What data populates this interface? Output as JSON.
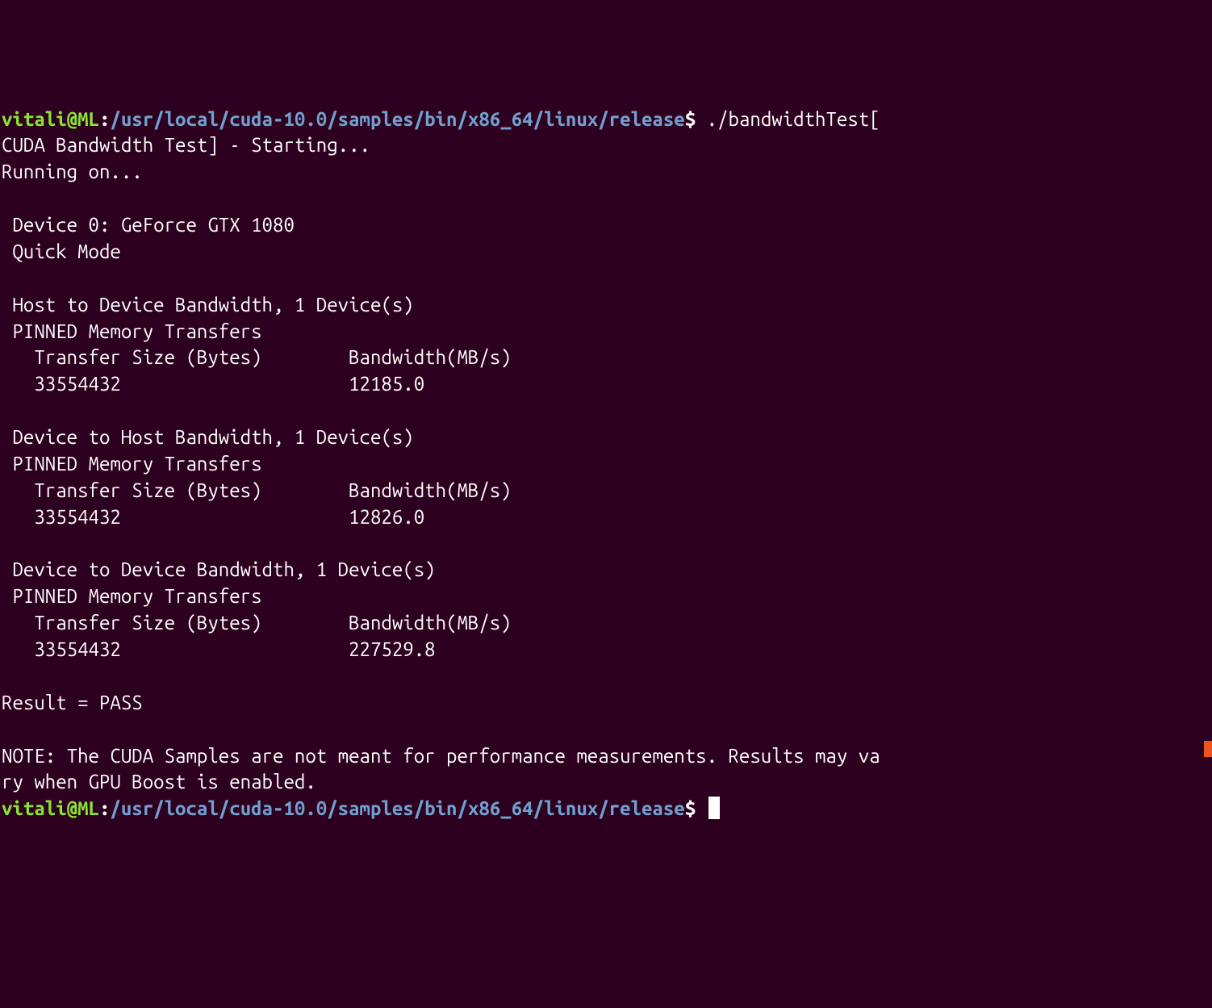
{
  "prompt1": {
    "user_host": "vitali@ML",
    "colon": ":",
    "path": "/usr/local/cuda-10.0/samples/bin/x86_64/linux/release",
    "dollar": "$",
    "command": " ./bandwidthTest["
  },
  "output": {
    "line1": "CUDA Bandwidth Test] - Starting...",
    "line2": "Running on...",
    "line3": "",
    "line4": " Device 0: GeForce GTX 1080",
    "line5": " Quick Mode",
    "line6": "",
    "line7": " Host to Device Bandwidth, 1 Device(s)",
    "line8": " PINNED Memory Transfers",
    "line9": "   Transfer Size (Bytes)        Bandwidth(MB/s)",
    "line10": "   33554432                     12185.0",
    "line11": "",
    "line12": " Device to Host Bandwidth, 1 Device(s)",
    "line13": " PINNED Memory Transfers",
    "line14": "   Transfer Size (Bytes)        Bandwidth(MB/s)",
    "line15": "   33554432                     12826.0",
    "line16": "",
    "line17": " Device to Device Bandwidth, 1 Device(s)",
    "line18": " PINNED Memory Transfers",
    "line19": "   Transfer Size (Bytes)        Bandwidth(MB/s)",
    "line20": "   33554432                     227529.8",
    "line21": "",
    "line22": "Result = PASS",
    "line23": "",
    "line24": "NOTE: The CUDA Samples are not meant for performance measurements. Results may va",
    "line25": "ry when GPU Boost is enabled."
  },
  "prompt2": {
    "user_host": "vitali@ML",
    "colon": ":",
    "path": "/usr/local/cuda-10.0/samples/bin/x86_64/linux/release",
    "dollar": "$"
  }
}
